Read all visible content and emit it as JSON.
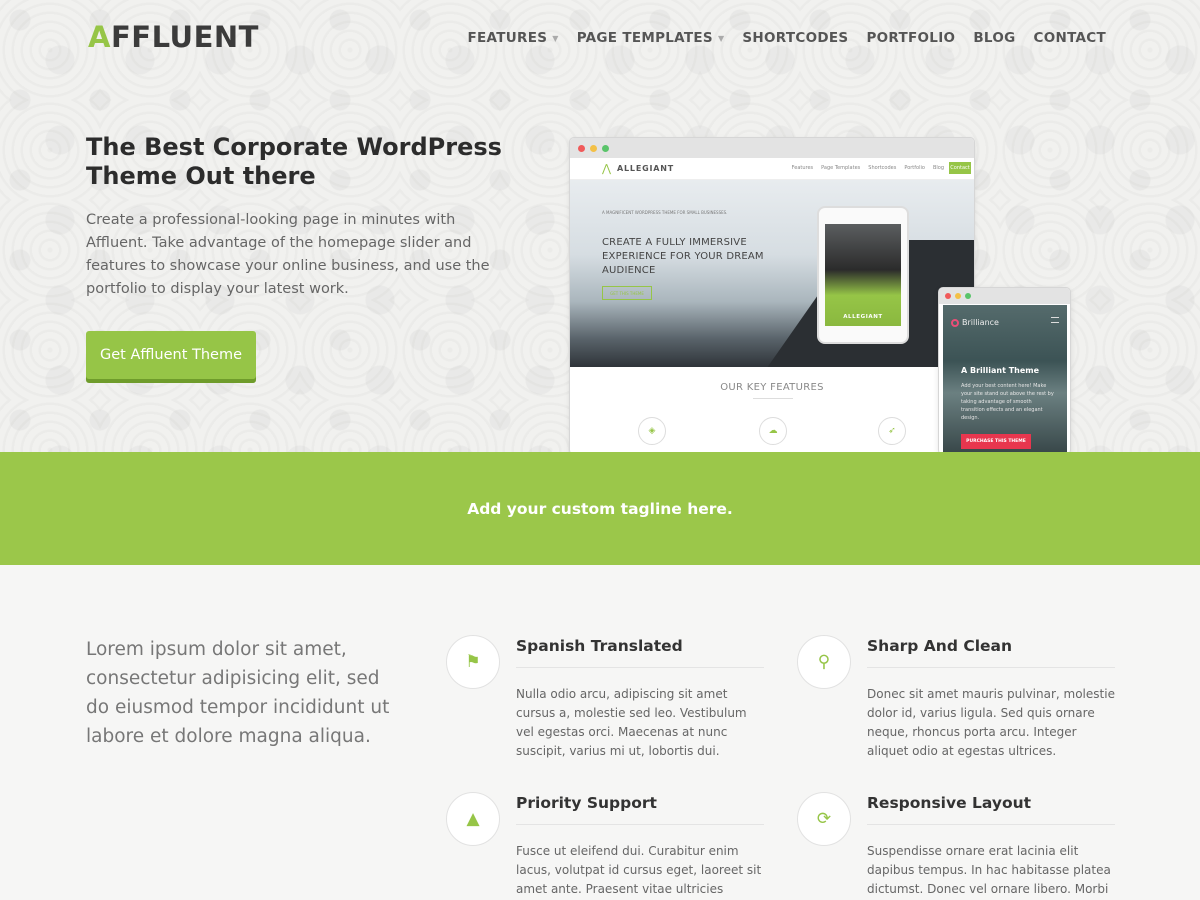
{
  "logo": {
    "first_letter": "A",
    "rest": "FFLUENT"
  },
  "nav": [
    {
      "label": "FEATURES",
      "has_dropdown": true
    },
    {
      "label": "PAGE TEMPLATES",
      "has_dropdown": true
    },
    {
      "label": "SHORTCODES",
      "has_dropdown": false
    },
    {
      "label": "PORTFOLIO",
      "has_dropdown": false
    },
    {
      "label": "BLOG",
      "has_dropdown": false
    },
    {
      "label": "CONTACT",
      "has_dropdown": false
    }
  ],
  "hero": {
    "title": "The Best Corporate WordPress Theme Out there",
    "text": "Create a professional-looking page in minutes with Affluent. Take advantage of the homepage slider and features to showcase your online business, and use the portfolio to display your latest work.",
    "button": "Get Affluent Theme"
  },
  "mockup_desktop": {
    "logo": "ALLEGIANT",
    "menu": [
      "Features",
      "Page Templates",
      "Shortcodes",
      "Portfolio",
      "Blog"
    ],
    "menu_cta": "Contact",
    "small_text": "A MAGNIFICENT WORDPRESS THEME FOR SMALL BUSINESSES.",
    "headline": "CREATE A FULLY IMMERSIVE EXPERIENCE FOR YOUR DREAM AUDIENCE",
    "button": "GET THIS THEME",
    "tablet_label": "ALLEGIANT",
    "features_heading": "OUR KEY FEATURES"
  },
  "mockup_phone": {
    "brand": "Brilliance",
    "title": "A Brilliant Theme",
    "text": "Add your best content here! Make your site stand out above the rest by taking advantage of smooth transition effects and an elegant design.",
    "button": "PURCHASE THIS THEME"
  },
  "tagline": "Add your custom tagline here.",
  "intro": "Lorem ipsum dolor sit amet, consectetur adipisicing elit, sed do eiusmod tempor incididunt ut labore et dolore magna aliqua.",
  "features": [
    {
      "icon": "flag-icon",
      "title": "Spanish Translated",
      "text": "Nulla odio arcu, adipiscing sit amet cursus a, molestie sed leo. Vestibulum vel egestas orci. Maecenas at nunc suscipit, varius mi ut, lobortis dui."
    },
    {
      "icon": "map-pin-icon",
      "title": "Sharp And Clean",
      "text": "Donec sit amet mauris pulvinar, molestie dolor id, varius ligula. Sed quis ornare neque, rhoncus porta arcu. Integer aliquet odio at egestas ultrices."
    },
    {
      "icon": "road-icon",
      "title": "Priority Support",
      "text": "Fusce ut eleifend dui. Curabitur enim lacus, volutpat id cursus eget, laoreet sit amet ante. Praesent vitae ultricies metus."
    },
    {
      "icon": "refresh-icon",
      "title": "Responsive Layout",
      "text": "Suspendisse ornare erat lacinia elit dapibus tempus. In hac habitasse platea dictumst. Donec vel ornare libero. Morbi suscipit"
    }
  ],
  "colors": {
    "accent": "#96c547",
    "tagline_bg": "#9bc74a",
    "phone_button": "#e8364e"
  }
}
